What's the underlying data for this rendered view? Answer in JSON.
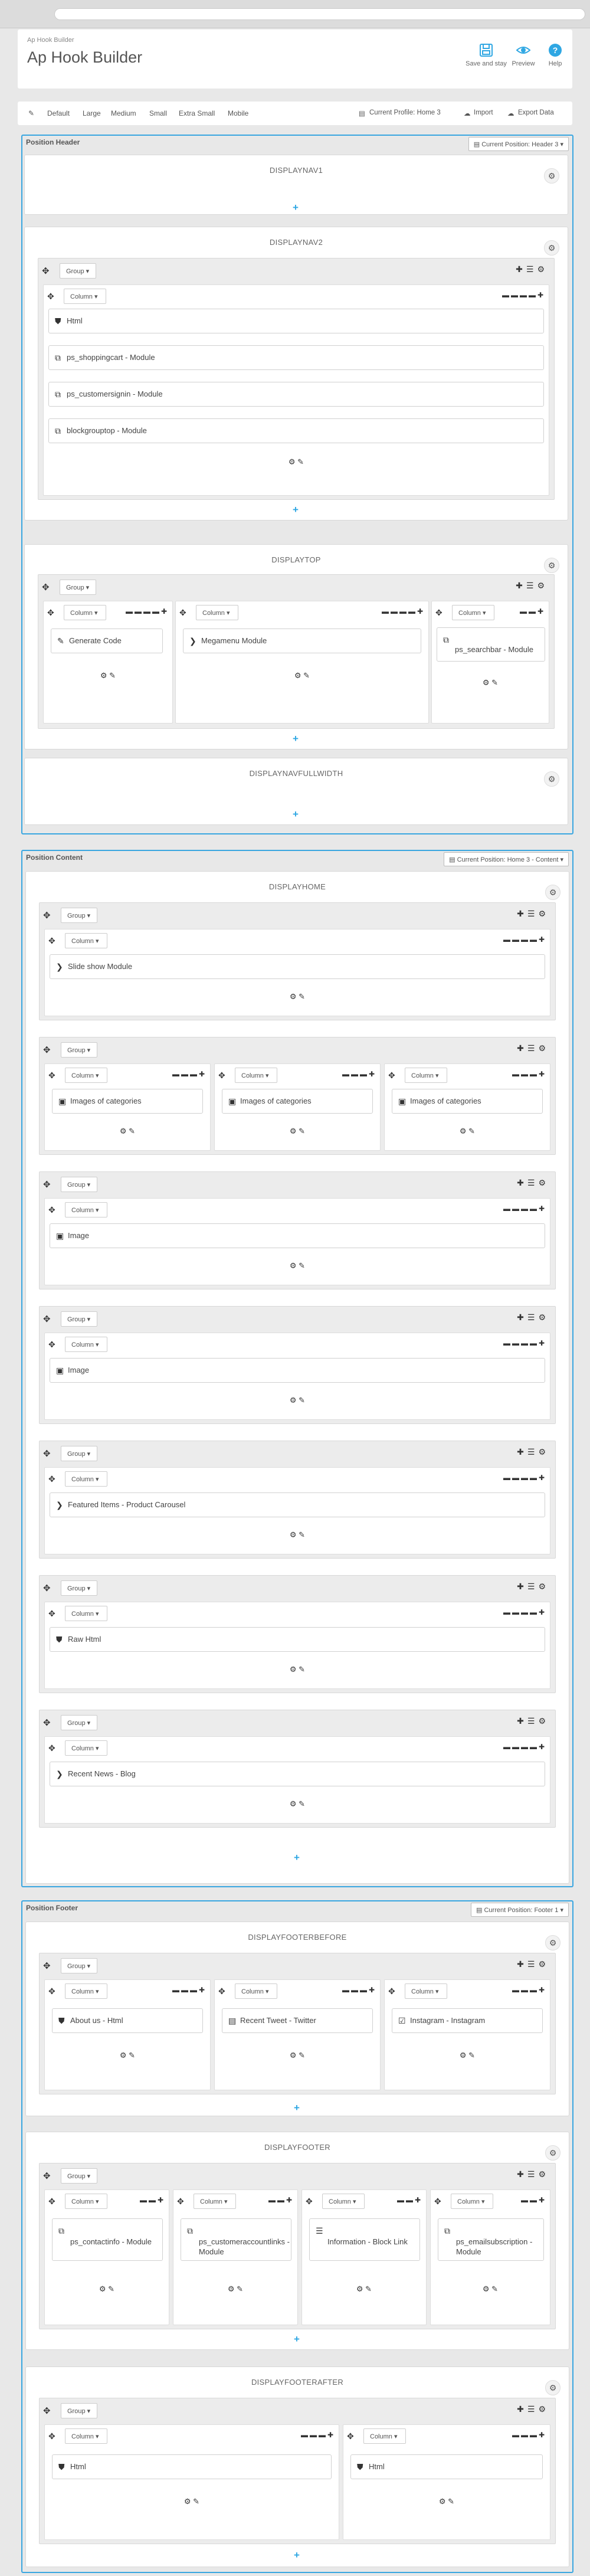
{
  "app": {
    "breadcrumb": "Ap Hook Builder",
    "title": "Ap Hook Builder",
    "toolbar": {
      "save": "Save and stay",
      "preview": "Preview",
      "help": "Help"
    }
  },
  "devices": {
    "items": [
      "Default",
      "Large",
      "Medium",
      "Small",
      "Extra Small",
      "Mobile"
    ],
    "profile": "Current Profile: Home 3",
    "import": "Import",
    "export": "Export Data"
  },
  "common": {
    "group": "Group",
    "column": "Column",
    "add": "+"
  },
  "header": {
    "title": "Position Header",
    "current": "Current Position: Header 3",
    "nav1": "DISPLAYNAV1",
    "nav2": "DISPLAYNAV2",
    "nav2_mods": [
      "Html",
      "ps_shoppingcart - Module",
      "ps_customersignin - Module",
      "blockgrouptop - Module"
    ],
    "top": "DISPLAYTOP",
    "top_mods": [
      "Generate Code",
      "Megamenu Module",
      "ps_searchbar - Module"
    ],
    "navfull": "DISPLAYNAVFULLWIDTH"
  },
  "content": {
    "title": "Position Content",
    "current": "Current Position: Home 3 - Content",
    "home": "DISPLAYHOME",
    "mods": {
      "slideshow": "Slide show Module",
      "cat1": "Images of categories",
      "cat2": "Images of categories",
      "cat3": "Images of categories",
      "image1": "Image",
      "image2": "Image",
      "featured": "Featured Items - Product Carousel",
      "raw": "Raw Html",
      "news": "Recent News - Blog"
    }
  },
  "footer": {
    "title": "Position Footer",
    "current": "Current Position: Footer 1",
    "before": "DISPLAYFOOTERBEFORE",
    "before_mods": [
      "About us - Html",
      "Recent Tweet - Twitter",
      "Instagram - Instagram"
    ],
    "footer": "DISPLAYFOOTER",
    "footer_mods": [
      "ps_contactinfo - Module",
      "ps_customeraccountlinks - Module",
      "Information - Block Link",
      "ps_emailsubscription - Module"
    ],
    "after": "DISPLAYFOOTERAFTER",
    "after_mods": [
      "Html",
      "Html"
    ]
  }
}
